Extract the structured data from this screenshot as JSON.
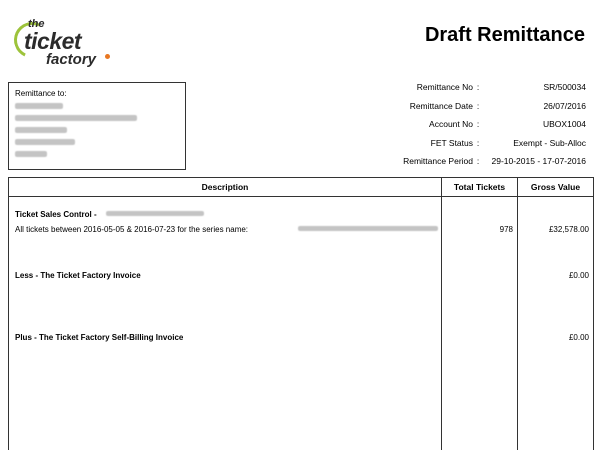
{
  "logo": {
    "line1": "the",
    "line2": "ticket",
    "line3": "factory"
  },
  "title": "Draft Remittance",
  "address": {
    "label": "Remittance to:"
  },
  "meta": [
    {
      "label": "Remittance No",
      "value": "SR/500034"
    },
    {
      "label": "Remittance Date",
      "value": "26/07/2016"
    },
    {
      "label": "Account No",
      "value": "UBOX1004"
    },
    {
      "label": "FET Status",
      "value": "Exempt - Sub-Alloc"
    },
    {
      "label": "Remittance Period",
      "value": "29-10-2015 - 17-07-2016"
    }
  ],
  "colon": ":",
  "table": {
    "headers": {
      "description": "Description",
      "total_tickets": "Total Tickets",
      "gross_value": "Gross Value"
    },
    "rows": [
      {
        "title": "Ticket Sales Control -",
        "detail": "All tickets between 2016-05-05 & 2016-07-23 for the series name:",
        "tickets": "978",
        "gross": "£32,578.00"
      },
      {
        "title": "Less - The Ticket Factory Invoice",
        "gross": "£0.00"
      },
      {
        "title": "Plus - The Ticket Factory Self-Billing Invoice",
        "gross": "£0.00"
      }
    ]
  },
  "colors": {
    "brand_green": "#9dc33b",
    "brand_orange": "#e87722",
    "redaction": "#c4c4c4"
  }
}
